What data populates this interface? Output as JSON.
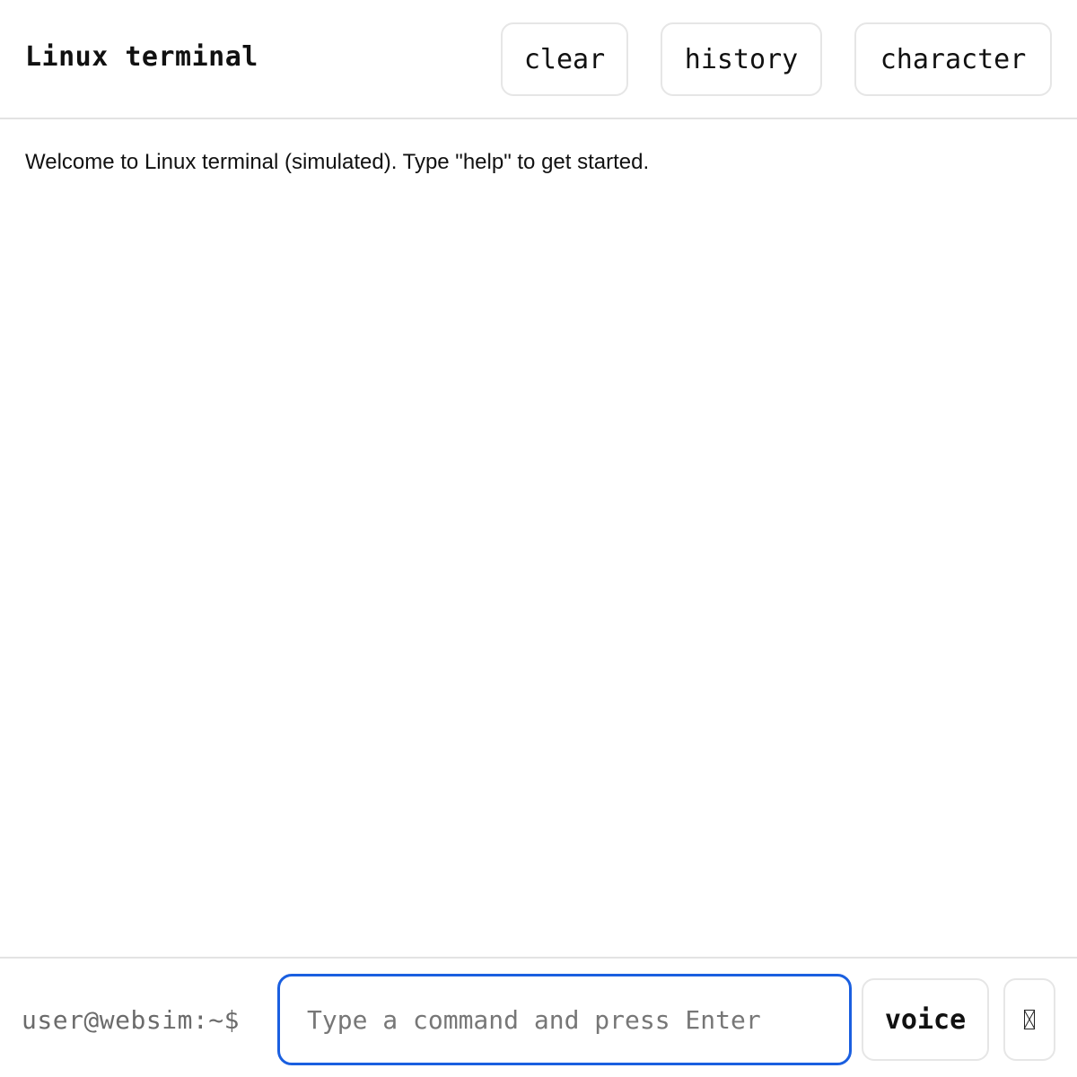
{
  "header": {
    "title": "Linux terminal",
    "buttons": {
      "clear": "clear",
      "history": "history",
      "character": "character"
    }
  },
  "output": {
    "welcome": "Welcome to Linux terminal (simulated). Type \"help\" to get started."
  },
  "footer": {
    "prompt": "user@websim:~$",
    "input": {
      "value": "",
      "placeholder": "Type a command and press Enter"
    },
    "voice_label": "voice",
    "extra_button_icon": "missing-glyph-icon"
  },
  "colors": {
    "accent": "#1a5fe0",
    "border": "#e3e3e3",
    "text": "#111111",
    "muted": "#6b6b6b"
  }
}
